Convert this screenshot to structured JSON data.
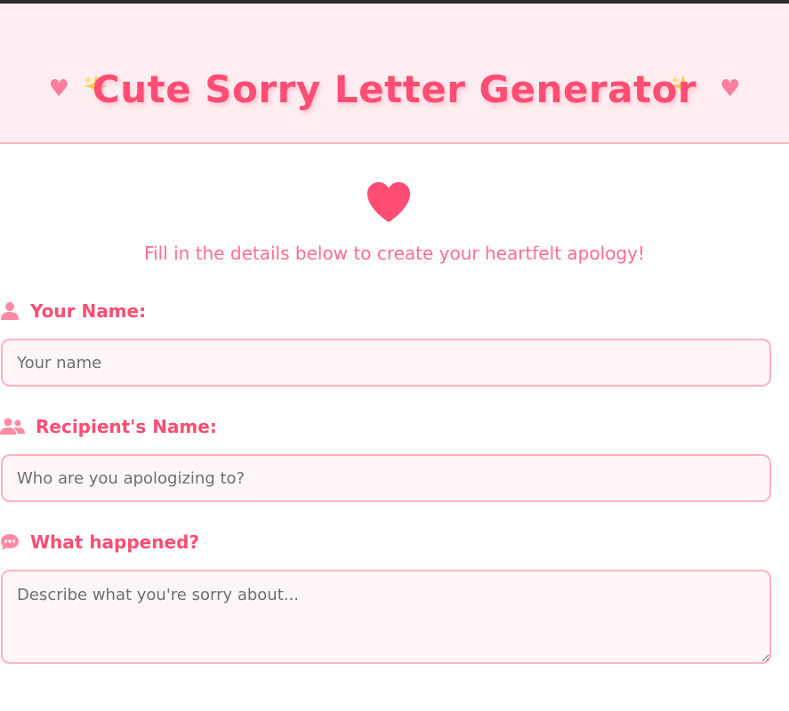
{
  "header": {
    "title": "Cute Sorry Letter Generator",
    "heart_glyph": "♥"
  },
  "intro": {
    "subtitle": "Fill in the details below to create your heartfelt apology!"
  },
  "form": {
    "your_name": {
      "label": "Your Name:",
      "placeholder": "Your name",
      "value": ""
    },
    "recipient_name": {
      "label": "Recipient's Name:",
      "placeholder": "Who are you apologizing to?",
      "value": ""
    },
    "what_happened": {
      "label": "What happened?",
      "placeholder": "Describe what you're sorry about...",
      "value": ""
    }
  },
  "icons": {
    "header_hearts": "heart-icon",
    "header_sparkles": "sparkle-icon",
    "big_heart": "heart-icon",
    "your_name": "user-icon",
    "recipient_name": "users-icon",
    "what_happened": "comment-dots-icon"
  },
  "colors": {
    "accent": "#ff4d73",
    "header_bg": "#ffeef1",
    "border": "#ffb3c4",
    "subtitle": "#ff6f8f",
    "icon": "#ff8aa6"
  }
}
